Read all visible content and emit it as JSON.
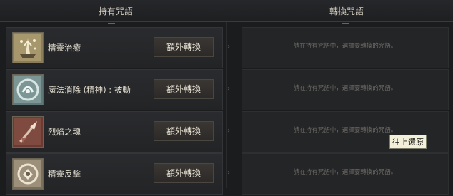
{
  "header": {
    "left_title": "持有咒語",
    "right_title": "轉換咒語"
  },
  "rows": [
    {
      "name": "精靈治癒",
      "button": "額外轉換",
      "hint": "請在持有咒語中，選擇要轉換的咒語。",
      "icon": "spirit-heal-icon",
      "accent": "#c8b68a"
    },
    {
      "name": "魔法消除 (精神) : 被動",
      "button": "額外轉換",
      "hint": "請在持有咒語中，選擇要轉換的咒語。",
      "icon": "magic-cancel-icon",
      "accent": "#8fb3b0"
    },
    {
      "name": "烈焰之魂",
      "button": "額外轉換",
      "hint": "請在持有咒語中，選擇要轉換的咒語。",
      "icon": "flame-soul-icon",
      "accent": "#b06a5a"
    },
    {
      "name": "精靈反擊",
      "button": "額外轉換",
      "hint": "請在持有咒語中，選擇要轉換的咒語。",
      "icon": "spirit-counter-icon",
      "accent": "#c8bca2"
    }
  ],
  "tooltip": "往上還原"
}
